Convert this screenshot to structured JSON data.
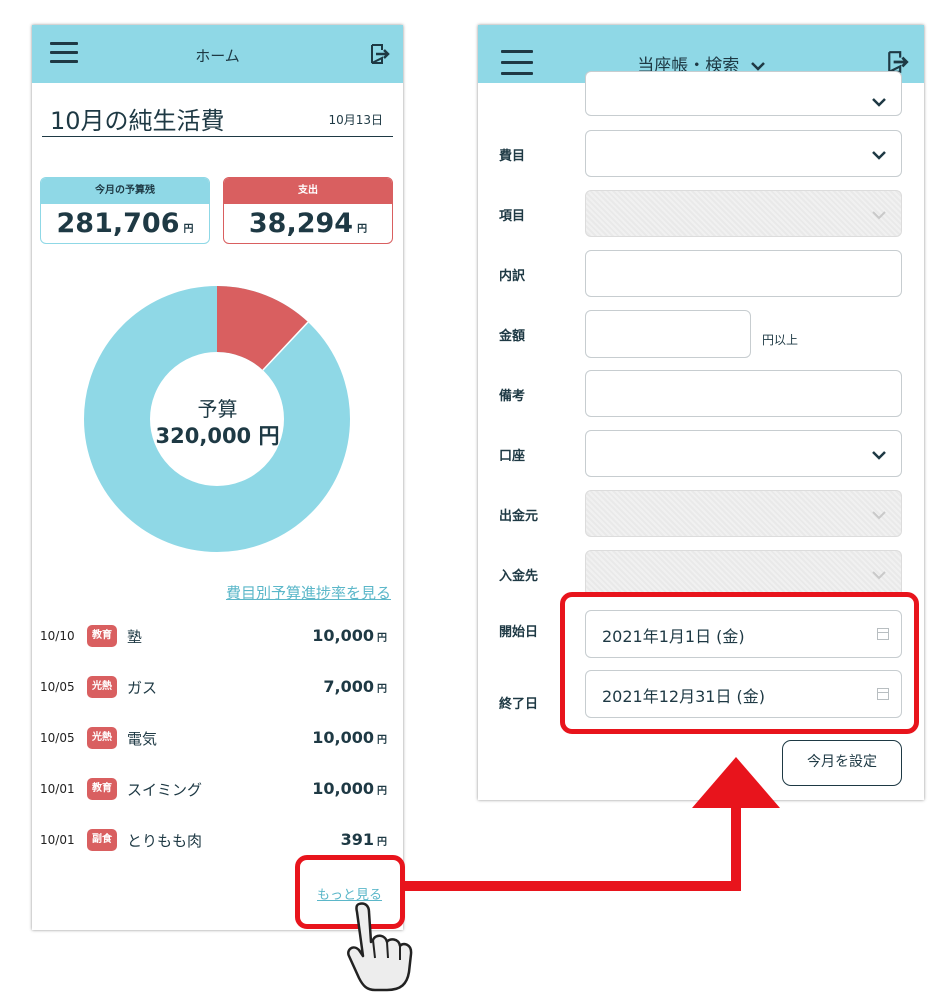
{
  "left_screen": {
    "header_title": "ホーム",
    "summary_title": "10月の純生活費",
    "summary_date": "10月13日",
    "budget_card": {
      "label": "今月の予算残",
      "value": "281,706",
      "unit": "円"
    },
    "expense_card": {
      "label": "支出",
      "value": "38,294",
      "unit": "円"
    },
    "donut": {
      "center_label": "予算",
      "center_value": "320,000 円",
      "spent_fraction": 0.12,
      "colors": {
        "remaining": "#8fd8e6",
        "spent": "#d95f60"
      }
    },
    "progress_link": "費目別予算進捗率を見る",
    "transactions": [
      {
        "date": "10/10",
        "tag": "教育",
        "name": "塾",
        "amount": "10,000",
        "unit": "円"
      },
      {
        "date": "10/05",
        "tag": "光熱",
        "name": "ガス",
        "amount": "7,000",
        "unit": "円"
      },
      {
        "date": "10/05",
        "tag": "光熱",
        "name": "電気",
        "amount": "10,000",
        "unit": "円"
      },
      {
        "date": "10/01",
        "tag": "教育",
        "name": "スイミング",
        "amount": "10,000",
        "unit": "円"
      },
      {
        "date": "10/01",
        "tag": "副食",
        "name": "とりもも肉",
        "amount": "391",
        "unit": "円"
      }
    ],
    "more_link": "もっと見る"
  },
  "right_screen": {
    "header_title": "当座帳・検索",
    "fields": {
      "category": "費目",
      "item": "項目",
      "detail": "内訳",
      "amount": "金額",
      "amount_suffix": "円以上",
      "note": "備考",
      "account": "口座",
      "source": "出金元",
      "destination": "入金先",
      "start_date": "開始日",
      "end_date": "終了日"
    },
    "start_date_value": "2021年1月1日 (金)",
    "end_date_value": "2021年12月31日 (金)",
    "this_month_button": "今月を設定"
  },
  "colors": {
    "header": "#8fd8e6",
    "accent_red": "#d95f60",
    "highlight_red": "#e8141c",
    "text_dark": "#1e3944"
  }
}
